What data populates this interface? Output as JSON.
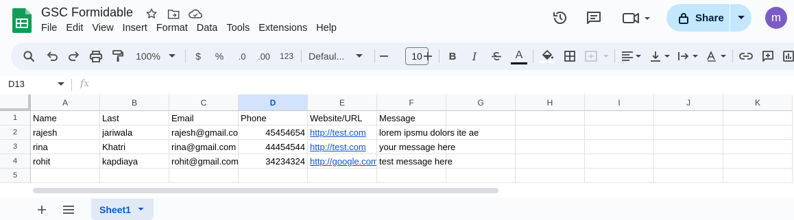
{
  "app": {
    "title": "GSC Formidable",
    "menu": [
      "File",
      "Edit",
      "View",
      "Insert",
      "Format",
      "Data",
      "Tools",
      "Extensions",
      "Help"
    ],
    "share_label": "Share",
    "avatar_letter": "m",
    "brand_color": "#0f9d58",
    "accent_color": "#c2e7ff"
  },
  "toolbar": {
    "zoom": "100%",
    "currency": "$",
    "percent": "%",
    "decrease_decimal": ".0",
    "increase_decimal": ".00",
    "number_format": "123",
    "font_name": "Defaul...",
    "font_size": "10",
    "bold": "B",
    "italic": "I",
    "text_color_label": "A"
  },
  "formula_bar": {
    "cell_ref": "D13",
    "fx": "fx",
    "value": ""
  },
  "grid": {
    "columns": [
      "A",
      "B",
      "C",
      "D",
      "E",
      "F",
      "G",
      "H",
      "I",
      "J",
      "K"
    ],
    "selected_column": "D",
    "row_numbers": [
      "1",
      "2",
      "3",
      "4",
      "5"
    ],
    "rows": [
      [
        "Name",
        "Last",
        "Email",
        "Phone",
        "Website/URL",
        "Message"
      ],
      [
        "rajesh",
        "jariwala",
        "rajesh@gmail.com",
        "45454654",
        "http://test.com",
        "lorem ipsmu dolors ite ae"
      ],
      [
        "rina",
        "Khatri",
        "rina@gmail.com",
        "44454544",
        "http://test.com",
        "your message here"
      ],
      [
        "rohit",
        "kapdiaya",
        "rohit@gmail.com",
        "34234324",
        "http://google.com",
        "test message here"
      ],
      [
        "",
        "",
        "",
        "",
        "",
        ""
      ]
    ]
  },
  "sheets": {
    "active": "Sheet1"
  }
}
